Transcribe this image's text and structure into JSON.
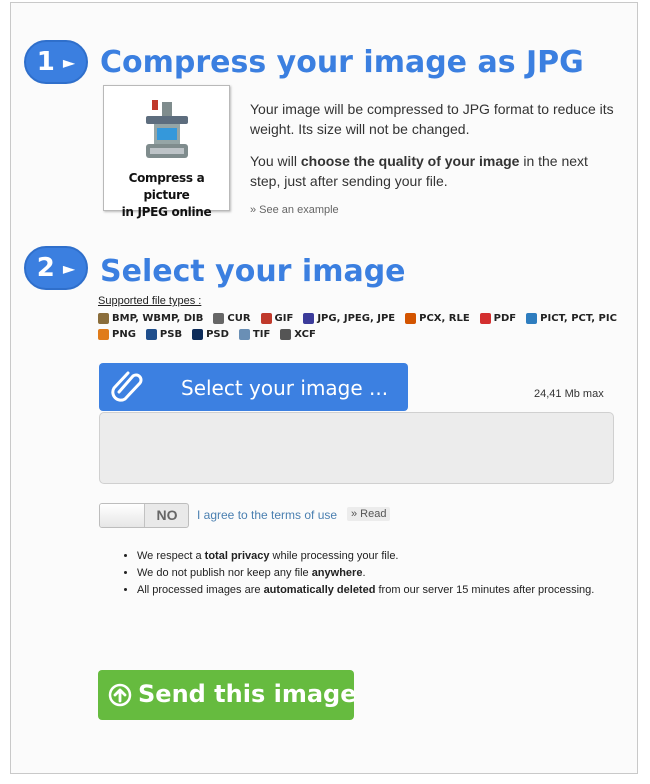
{
  "step1": {
    "number": "1",
    "arrow": "►",
    "title": "Compress your image as JPG",
    "thumbnail_caption_line1": "Compress a picture",
    "thumbnail_caption_line2": "in JPEG online",
    "desc_p1": "Your image will be compressed to JPG format to reduce its weight. Its size will not be changed.",
    "desc_p2_pre": "You will ",
    "desc_p2_bold": "choose the quality of your image",
    "desc_p2_post": " in the next step, just after sending your file.",
    "see_example": "» See an example"
  },
  "step2": {
    "number": "2",
    "arrow": "►",
    "title": "Select your image",
    "supported_label": "Supported file types :",
    "file_types_row1": [
      {
        "label": "BMP, WBMP, DIB",
        "icon": "bmp-icon",
        "color": "#8a6d3b"
      },
      {
        "label": "CUR",
        "icon": "cursor-icon",
        "color": "#666666"
      },
      {
        "label": "GIF",
        "icon": "gif-icon",
        "color": "#c0392b"
      },
      {
        "label": "JPG, JPEG, JPE",
        "icon": "jpg-icon",
        "color": "#3b3b9a"
      },
      {
        "label": "PCX, RLE",
        "icon": "pcx-icon",
        "color": "#d35400"
      },
      {
        "label": "PDF",
        "icon": "pdf-icon",
        "color": "#d32f2f"
      },
      {
        "label": "PICT, PCT, PIC",
        "icon": "pict-icon",
        "color": "#2e7dbf"
      }
    ],
    "file_types_row2": [
      {
        "label": "PNG",
        "icon": "png-icon",
        "color": "#e07b1a"
      },
      {
        "label": "PSB",
        "icon": "psb-icon",
        "color": "#1f4e8c"
      },
      {
        "label": "PSD",
        "icon": "psd-icon",
        "color": "#0d2c5a"
      },
      {
        "label": "TIF",
        "icon": "tif-icon",
        "color": "#6a8fb5"
      },
      {
        "label": "XCF",
        "icon": "xcf-icon",
        "color": "#555555"
      }
    ],
    "select_button": "Select your image ...",
    "max_size": "24,41 Mb max",
    "terms_toggle": "NO",
    "agree_text": "I agree to the terms of use",
    "read_link": "» Read"
  },
  "privacy": [
    {
      "pre": "We respect a ",
      "bold": "total privacy",
      "post": " while processing your file."
    },
    {
      "pre": "We do not publish nor keep any file ",
      "bold": "anywhere",
      "post": "."
    },
    {
      "pre": "All processed images are ",
      "bold": "automatically deleted",
      "post": " from our server 15 minutes after processing."
    }
  ],
  "send_button": "Send this image",
  "colors": {
    "accent": "#3b7fe0",
    "send": "#66bb3f"
  }
}
